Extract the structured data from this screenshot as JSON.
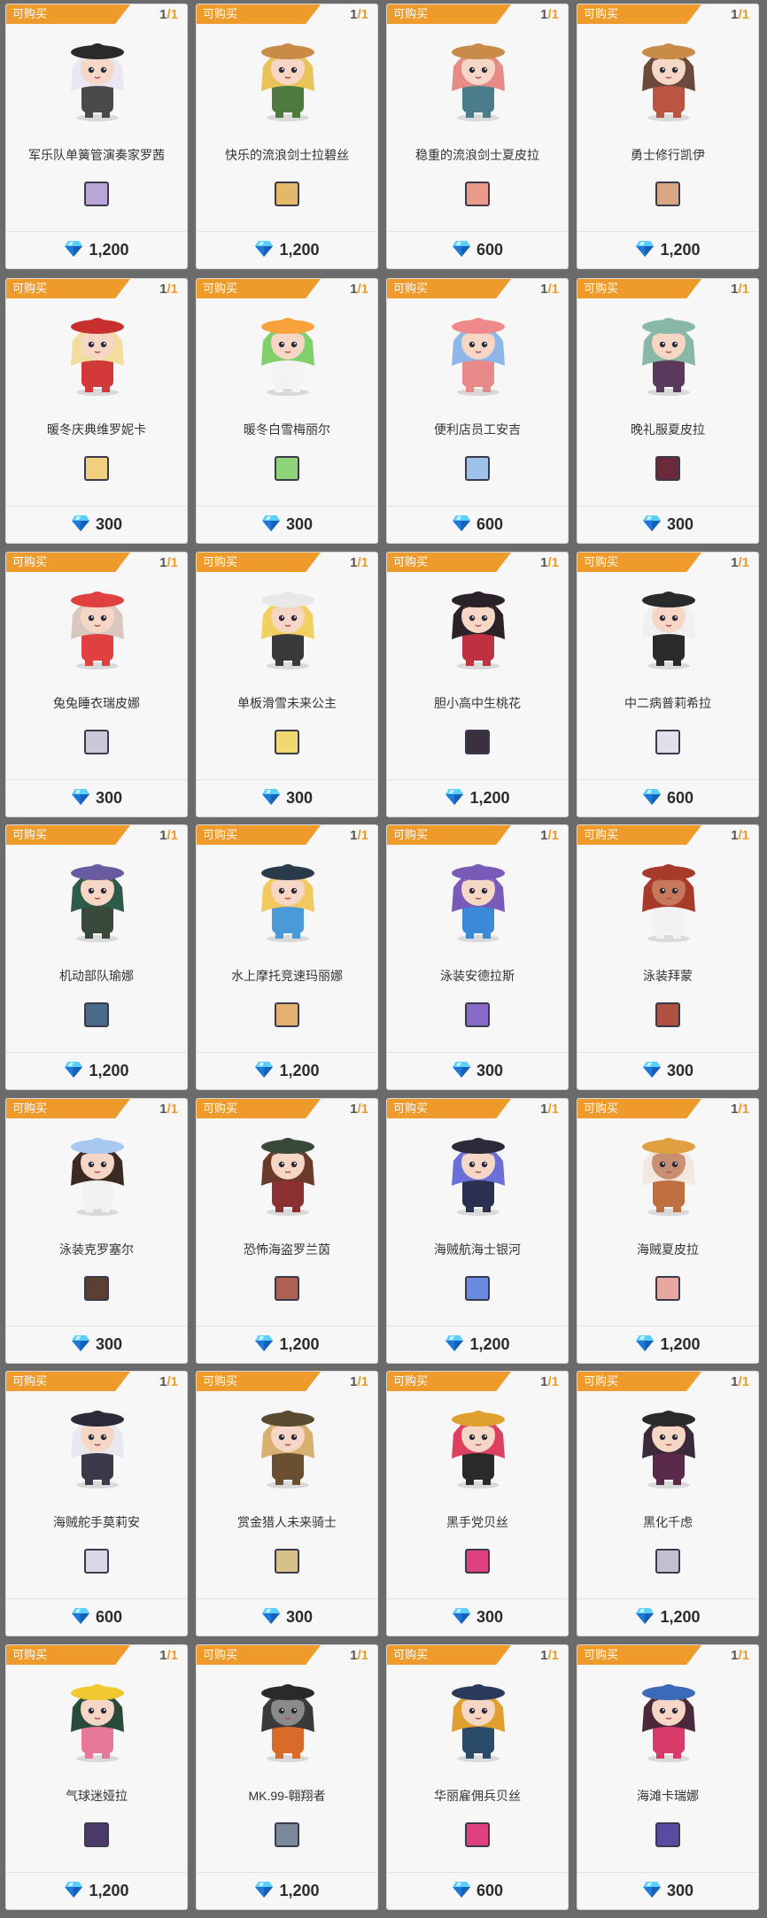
{
  "tag_label": "可购买",
  "items": [
    {
      "name": "军乐队单簧管演奏家罗茜",
      "price": "1,200",
      "count": "1",
      "limit": "/1",
      "hair": "#e9e7f2",
      "outfit": "#4a4a4a",
      "hat": "#2a2a2a",
      "skin": "#f6d6c4",
      "thumb": "#b8a6d6"
    },
    {
      "name": "快乐的流浪剑士拉碧丝",
      "price": "1,200",
      "count": "1",
      "limit": "/1",
      "hair": "#e9c25a",
      "outfit": "#4f7a3f",
      "hat": "#c98b48",
      "skin": "#f6d6c4",
      "thumb": "#e3b86a"
    },
    {
      "name": "稳重的流浪剑士夏皮拉",
      "price": "600",
      "count": "1",
      "limit": "/1",
      "hair": "#e78b87",
      "outfit": "#4a7c8a",
      "hat": "#c98b48",
      "skin": "#f6d6c4",
      "thumb": "#e99a8a"
    },
    {
      "name": "勇士修行凯伊",
      "price": "1,200",
      "count": "1",
      "limit": "/1",
      "hair": "#6b4a3a",
      "outfit": "#b95540",
      "hat": "#c98b48",
      "skin": "#f6d6c4",
      "thumb": "#d8a884"
    },
    {
      "name": "暖冬庆典维罗妮卡",
      "price": "300",
      "count": "1",
      "limit": "/1",
      "hair": "#f2dca0",
      "outfit": "#d23a3a",
      "hat": "#c83030",
      "skin": "#f6d6c4",
      "thumb": "#f0d080"
    },
    {
      "name": "暖冬白雪梅丽尔",
      "price": "300",
      "count": "1",
      "limit": "/1",
      "hair": "#7fd06a",
      "outfit": "#f3f3f3",
      "hat": "#f7a23a",
      "skin": "#f6d6c4",
      "thumb": "#8ed47a"
    },
    {
      "name": "便利店员工安吉",
      "price": "600",
      "count": "1",
      "limit": "/1",
      "hair": "#8fb6e8",
      "outfit": "#e88a8a",
      "hat": "#f08a8a",
      "skin": "#f6d6c4",
      "thumb": "#9fc2ec"
    },
    {
      "name": "晚礼服夏皮拉",
      "price": "300",
      "count": "1",
      "limit": "/1",
      "hair": "#8ab8a8",
      "outfit": "#5a3a5a",
      "hat": "#8ab8a8",
      "skin": "#f6d6c4",
      "thumb": "#6a2a3a"
    },
    {
      "name": "兔兔睡衣瑞皮娜",
      "price": "300",
      "count": "1",
      "limit": "/1",
      "hair": "#d8c8c0",
      "outfit": "#e04040",
      "hat": "#e04040",
      "skin": "#f6d6c4",
      "thumb": "#c8c8d8"
    },
    {
      "name": "单板滑雪未来公主",
      "price": "300",
      "count": "1",
      "limit": "/1",
      "hair": "#f2d060",
      "outfit": "#3a3a3a",
      "hat": "#e8e8e8",
      "skin": "#f6d6c4",
      "thumb": "#f2d870"
    },
    {
      "name": "胆小高中生桃花",
      "price": "1,200",
      "count": "1",
      "limit": "/1",
      "hair": "#2a2228",
      "outfit": "#c03040",
      "hat": "#2a2228",
      "skin": "#f6d6c4",
      "thumb": "#3a3040"
    },
    {
      "name": "中二病普莉希拉",
      "price": "600",
      "count": "1",
      "limit": "/1",
      "hair": "#f0f0f0",
      "outfit": "#2a2a2a",
      "hat": "#2a2a2a",
      "skin": "#f6d6c4",
      "thumb": "#e0e0ea"
    },
    {
      "name": "机动部队瑜娜",
      "price": "1,200",
      "count": "1",
      "limit": "/1",
      "hair": "#2e5a4a",
      "outfit": "#3a4a3a",
      "hat": "#6a5aa0",
      "skin": "#f6d6c4",
      "thumb": "#4a6a8a"
    },
    {
      "name": "水上摩托竞速玛丽娜",
      "price": "1,200",
      "count": "1",
      "limit": "/1",
      "hair": "#f2c860",
      "outfit": "#4a9ad8",
      "hat": "#2a3a4a",
      "skin": "#f6d6c4",
      "thumb": "#e6b070"
    },
    {
      "name": "泳装安德拉斯",
      "price": "300",
      "count": "1",
      "limit": "/1",
      "hair": "#7a5ab8",
      "outfit": "#3a8ad8",
      "hat": "#7a5ab8",
      "skin": "#f6d6c4",
      "thumb": "#8a6ac8"
    },
    {
      "name": "泳装拜蒙",
      "price": "300",
      "count": "1",
      "limit": "/1",
      "hair": "#a83a2a",
      "outfit": "#f2f2f2",
      "hat": "#a83a2a",
      "skin": "#c8785a",
      "thumb": "#b05040"
    },
    {
      "name": "泳装克罗塞尔",
      "price": "300",
      "count": "1",
      "limit": "/1",
      "hair": "#3a2a22",
      "outfit": "#f2f2f2",
      "hat": "#a8c8f0",
      "skin": "#f6d6c4",
      "thumb": "#5a4030"
    },
    {
      "name": "恐怖海盗罗兰茵",
      "price": "1,200",
      "count": "1",
      "limit": "/1",
      "hair": "#6a3a2a",
      "outfit": "#8a3030",
      "hat": "#3a4a3a",
      "skin": "#f6d6c4",
      "thumb": "#b06050"
    },
    {
      "name": "海贼航海士银河",
      "price": "1,200",
      "count": "1",
      "limit": "/1",
      "hair": "#6a70d8",
      "outfit": "#2a3050",
      "hat": "#2a2a3a",
      "skin": "#f6d6c4",
      "thumb": "#6a8ae0"
    },
    {
      "name": "海贼夏皮拉",
      "price": "1,200",
      "count": "1",
      "limit": "/1",
      "hair": "#f2e8e0",
      "outfit": "#c07040",
      "hat": "#e0a040",
      "skin": "#c89070",
      "thumb": "#e6a8a0"
    },
    {
      "name": "海贼舵手莫莉安",
      "price": "600",
      "count": "1",
      "limit": "/1",
      "hair": "#e8e8f0",
      "outfit": "#3a3a4a",
      "hat": "#2a2a3a",
      "skin": "#f6d6c4",
      "thumb": "#d8d8e8"
    },
    {
      "name": "赏金猎人未来骑士",
      "price": "300",
      "count": "1",
      "limit": "/1",
      "hair": "#d8b070",
      "outfit": "#6a5030",
      "hat": "#5a4a30",
      "skin": "#f6d6c4",
      "thumb": "#d8c08a"
    },
    {
      "name": "黑手党贝丝",
      "price": "300",
      "count": "1",
      "limit": "/1",
      "hair": "#e04060",
      "outfit": "#2a2a2a",
      "hat": "#e0a030",
      "skin": "#f6d6c4",
      "thumb": "#e04080"
    },
    {
      "name": "黑化千虑",
      "price": "1,200",
      "count": "1",
      "limit": "/1",
      "hair": "#3a2a3a",
      "outfit": "#5a2a4a",
      "hat": "#2a2a2a",
      "skin": "#f6d6c4",
      "thumb": "#c0c0d0"
    },
    {
      "name": "气球迷娅拉",
      "price": "1,200",
      "count": "1",
      "limit": "/1",
      "hair": "#2a4a3a",
      "outfit": "#e8789a",
      "hat": "#f2c830",
      "skin": "#f6d6c4",
      "thumb": "#4a3a6a"
    },
    {
      "name": "MK.99-翱翔者",
      "price": "1,200",
      "count": "1",
      "limit": "/1",
      "hair": "#3a3a3a",
      "outfit": "#d86a2a",
      "hat": "#2a2a2a",
      "skin": "#8a8a8a",
      "thumb": "#7a8a9a"
    },
    {
      "name": "华丽雇佣兵贝丝",
      "price": "600",
      "count": "1",
      "limit": "/1",
      "hair": "#e0a030",
      "outfit": "#2a4a6a",
      "hat": "#2a3a5a",
      "skin": "#f6d6c4",
      "thumb": "#e04080"
    },
    {
      "name": "海滩卡瑞娜",
      "price": "300",
      "count": "1",
      "limit": "/1",
      "hair": "#4a2a3a",
      "outfit": "#d83a6a",
      "hat": "#3a6ab8",
      "skin": "#f6d6c4",
      "thumb": "#5a4aa0"
    }
  ],
  "colors": {
    "tag": "#ee9b2c",
    "gem_light": "#5ad0ff",
    "gem_dark": "#1e78d8"
  },
  "icons": {
    "currency": "diamond-gem-icon"
  }
}
